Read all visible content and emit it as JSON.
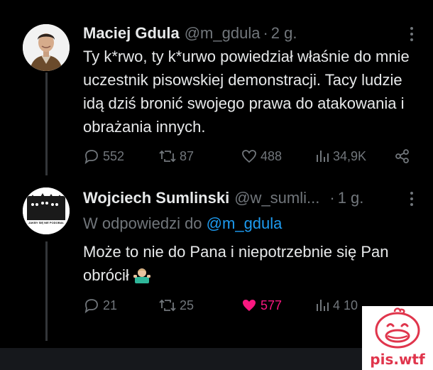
{
  "tweets": [
    {
      "name": "Maciej Gdula",
      "handle": "@m_gdula",
      "separator": "·",
      "time": "2 g.",
      "text": "Ty k*rwo, ty k*urwo powiedział właśnie do mnie uczestnik pisowskiej demonstracji. Tacy ludzie idą dziś bronić swojego prawa do atakowania i obrażania innych.",
      "replies": "552",
      "retweets": "87",
      "likes": "488",
      "views": "34,9K"
    },
    {
      "name": "Wojciech Sumlinski",
      "handle": "@w_sumli...",
      "separator": "·",
      "time": "1 g.",
      "reply_prefix": "W odpowiedzi do",
      "reply_mention": "@m_gdula",
      "text": "Może to nie do Pana i niepotrzebnie się Pan obrócił",
      "emoji": "person-shrugging-emoji",
      "replies": "21",
      "retweets": "25",
      "likes": "577",
      "views": "4 10",
      "like_active": true
    }
  ],
  "avatar2_caption": "JAKBY SIĘ NIE PODOBAŁO",
  "watermark": {
    "text": "pis.wtf",
    "icon": "duck-logo-icon"
  },
  "colors": {
    "background": "#000000",
    "text": "#e7e9ea",
    "muted": "#71767b",
    "link": "#1d9bf0",
    "like": "#f91880",
    "watermark": "#e0354c"
  }
}
